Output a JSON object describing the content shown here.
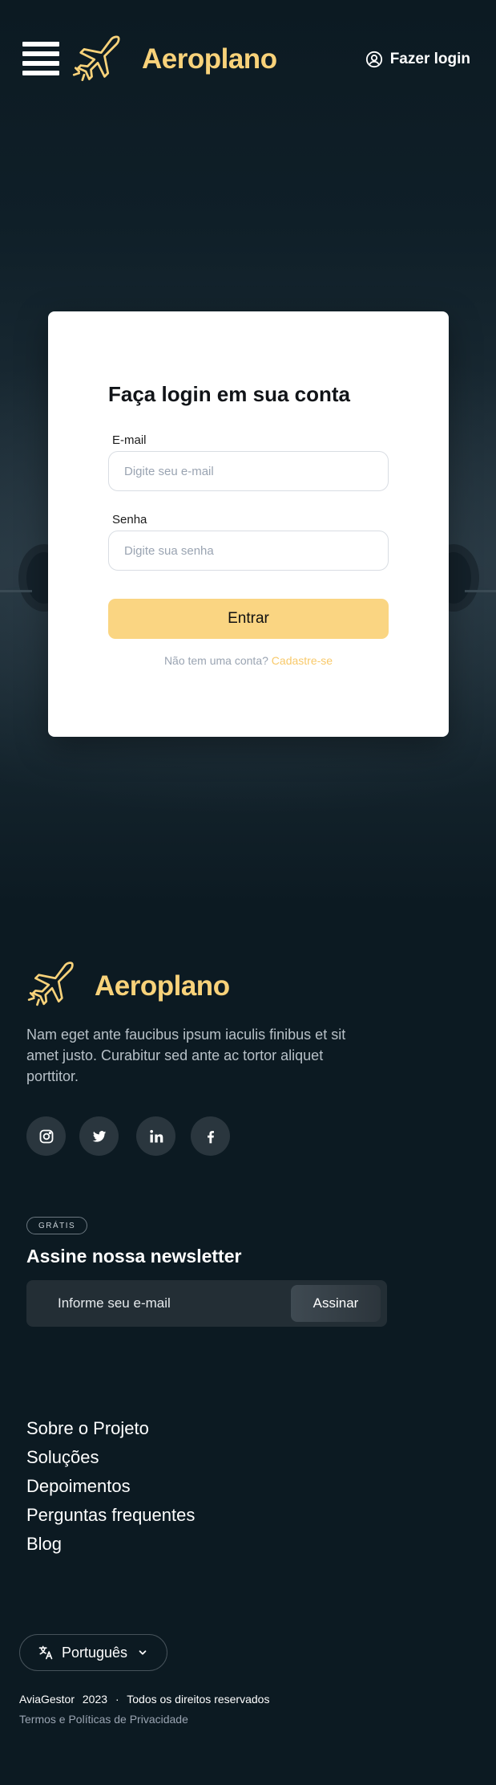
{
  "header": {
    "brand": "Aeroplano",
    "login_label": "Fazer login"
  },
  "login_card": {
    "title": "Faça login em sua conta",
    "email_label": "E-mail",
    "email_placeholder": "Digite seu e-mail",
    "password_label": "Senha",
    "password_placeholder": "Digite sua senha",
    "submit_label": "Entrar",
    "signup_prompt": "Não tem uma conta?",
    "signup_link": "Cadastre-se"
  },
  "footer": {
    "brand": "Aeroplano",
    "description": "Nam eget ante faucibus ipsum iaculis finibus et sit amet justo. Curabitur sed ante ac tortor aliquet porttitor.",
    "socials": [
      "instagram-icon",
      "twitter-icon",
      "linkedin-icon",
      "facebook-icon"
    ],
    "newsletter": {
      "badge": "GRÁTIS",
      "title": "Assine nossa newsletter",
      "placeholder": "Informe seu e-mail",
      "button": "Assinar"
    },
    "links": [
      "Sobre o Projeto",
      "Soluções",
      "Depoimentos",
      "Perguntas frequentes",
      "Blog"
    ],
    "language": "Português",
    "company": "AviaGestor",
    "year": "2023",
    "rights": "Todos os direitos reservados",
    "terms": "Termos e Políticas de Privacidade"
  },
  "colors": {
    "background": "#0c1a22",
    "brand_yellow": "#f8d27a",
    "button_yellow": "#fad582",
    "card": "#ffffff"
  }
}
